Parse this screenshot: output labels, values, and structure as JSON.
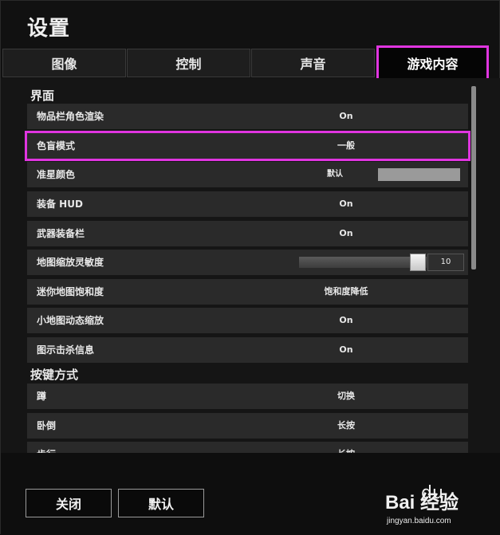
{
  "window": {
    "title": "设置"
  },
  "tabs": [
    {
      "label": "图像"
    },
    {
      "label": "控制"
    },
    {
      "label": "声音"
    },
    {
      "label": "游戏内容",
      "active": true
    }
  ],
  "sections": {
    "interface": {
      "title": "界面",
      "rows": [
        {
          "label": "物品栏角色渲染",
          "value": "On"
        },
        {
          "label": "色盲模式",
          "value": "一般"
        },
        {
          "label": "准星颜色",
          "value": "默认",
          "swatch_color": "#9a9a9a"
        },
        {
          "label": "装备 HUD",
          "value": "On"
        },
        {
          "label": "武器装备栏",
          "value": "On"
        },
        {
          "label": "地图缩放灵敏度",
          "value": "10"
        },
        {
          "label": "迷你地图饱和度",
          "value": "饱和度降低"
        },
        {
          "label": "小地图动态缩放",
          "value": "On"
        },
        {
          "label": "图示击杀信息",
          "value": "On"
        }
      ]
    },
    "keybinds": {
      "title": "按键方式",
      "rows": [
        {
          "label": "蹲",
          "value": "切换"
        },
        {
          "label": "卧倒",
          "value": "长按"
        },
        {
          "label": "步行",
          "value": "长按"
        }
      ]
    }
  },
  "footer": {
    "close_label": "关闭",
    "default_label": "默认"
  },
  "watermark": {
    "brand": "Bai  经验",
    "paw": "du",
    "url": "jingyan.baidu.com"
  },
  "colors": {
    "highlight": "#e035e0",
    "background": "#111111",
    "row": "#2a2a2a"
  }
}
